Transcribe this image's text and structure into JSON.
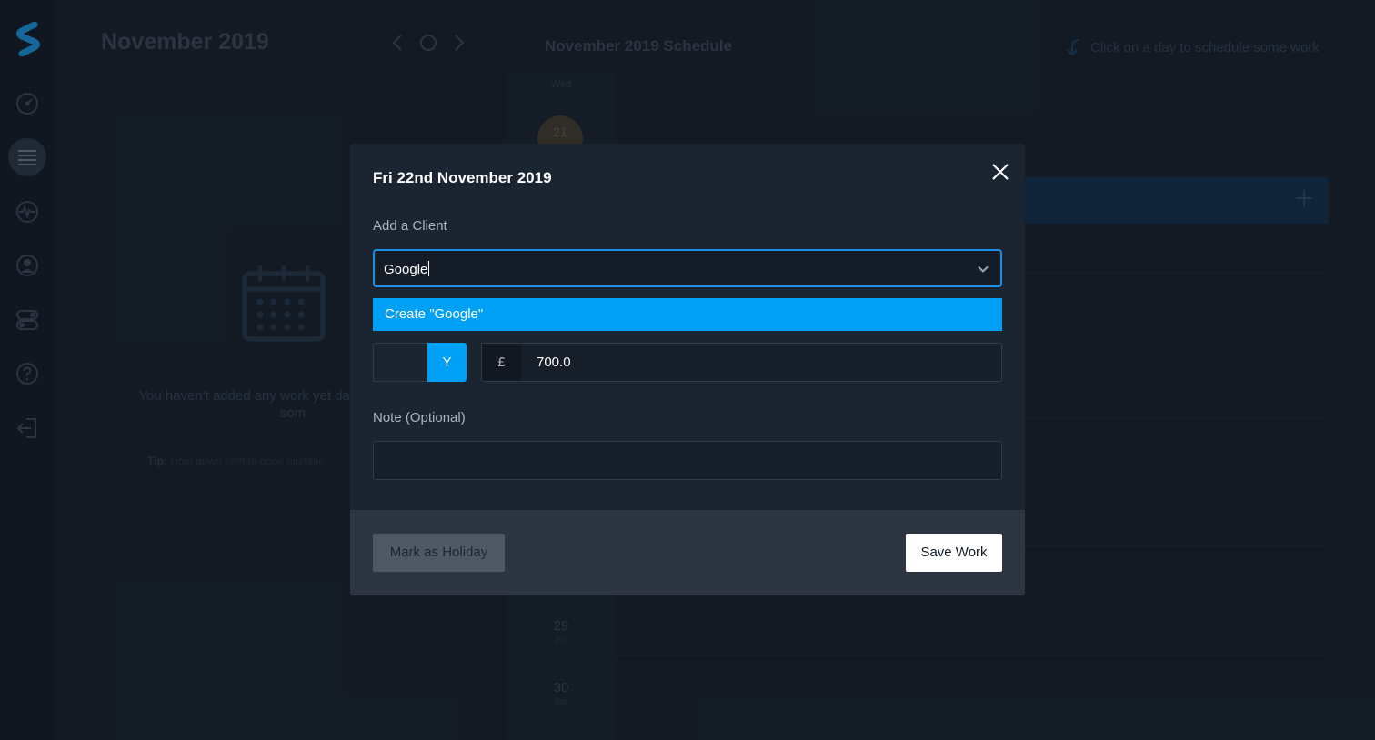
{
  "sidebar": {
    "logo": "logo-s",
    "items": [
      {
        "name": "dashboard-icon"
      },
      {
        "name": "schedule-list-icon",
        "active": true
      },
      {
        "name": "activity-icon"
      },
      {
        "name": "profile-icon"
      },
      {
        "name": "toggles-icon"
      },
      {
        "name": "help-icon"
      },
      {
        "name": "logout-icon"
      }
    ]
  },
  "calendar": {
    "month_title": "November 2019",
    "empty_text": "You haven't added any work yet day to start adding som",
    "tip_label": "Tip:",
    "tip_text": " Hold down shift to book multiple"
  },
  "schedule": {
    "title": "November 2019 Schedule",
    "hint": "Click on a day to schedule some work",
    "weekday_header": "Wed",
    "highlight_day": "21",
    "rows": [
      {
        "num": "29",
        "wd": "Fri"
      },
      {
        "num": "30",
        "wd": "Sat"
      }
    ]
  },
  "modal": {
    "title": "Fri 22nd November 2019",
    "client_label": "Add a Client",
    "client_value": "Google",
    "dropdown_option": "Create \"Google\"",
    "rate_toggle_selected": "Y",
    "currency": "£",
    "rate_value": "700.0",
    "note_label": "Note (Optional)",
    "note_value": "",
    "holiday_button": "Mark as Holiday",
    "save_button": "Save Work"
  },
  "colors": {
    "accent": "#00a0f6",
    "focus_border": "#1d8fe6",
    "background": "#17202c"
  }
}
